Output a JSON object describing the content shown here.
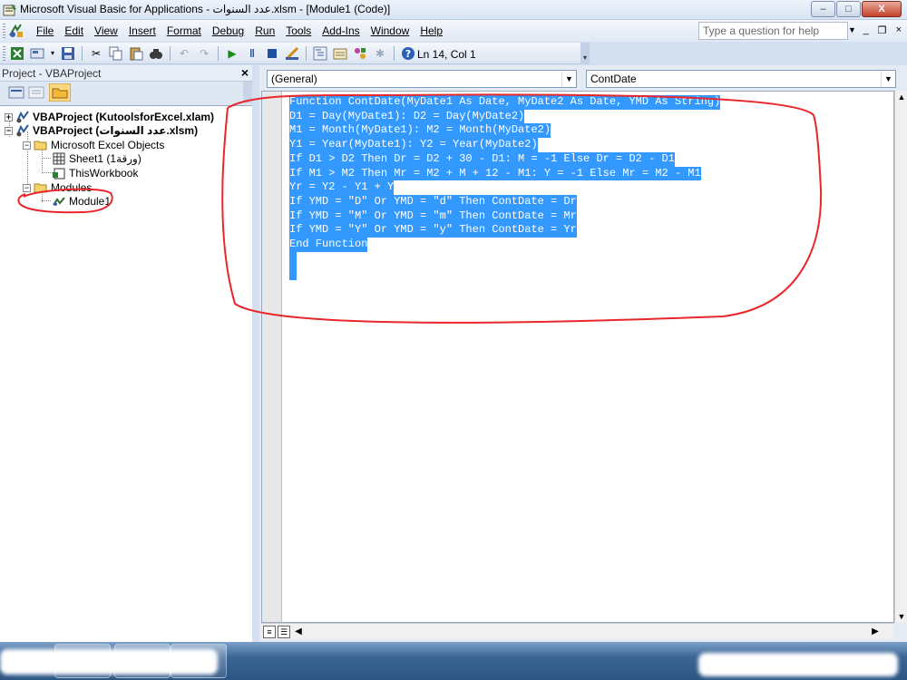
{
  "window": {
    "title": "Microsoft Visual Basic for Applications - عدد السنوات.xlsm - [Module1 (Code)]",
    "buttons": {
      "minimize": "–",
      "maximize": "□",
      "close": "X"
    }
  },
  "menubar": {
    "items": [
      "File",
      "Edit",
      "View",
      "Insert",
      "Format",
      "Debug",
      "Run",
      "Tools",
      "Add-Ins",
      "Window",
      "Help"
    ],
    "help_placeholder": "Type a question for help",
    "mdi_buttons": {
      "minimize": "_",
      "restore": "❐",
      "close": "×"
    }
  },
  "toolbar": {
    "status": "Ln 14, Col 1"
  },
  "project_pane": {
    "title": "Project - VBAProject",
    "close": "×",
    "tree": [
      {
        "label": "VBAProject (KutoolsforExcel.xlam)",
        "bold": true,
        "expander": "+"
      },
      {
        "label": "VBAProject (عدد السنوات.xlsm)",
        "bold": true,
        "expander": "−"
      },
      {
        "label": "Microsoft Excel Objects",
        "bold": false,
        "expander": "−"
      },
      {
        "label": "Sheet1 (ورقة1)",
        "bold": false
      },
      {
        "label": "ThisWorkbook",
        "bold": false
      },
      {
        "label": "Modules",
        "bold": false,
        "expander": "−"
      },
      {
        "label": "Module1",
        "bold": false
      }
    ]
  },
  "code_window": {
    "object_combo": "(General)",
    "procedure_combo": "ContDate",
    "lines": [
      "Function ContDate(MyDate1 As Date, MyDate2 As Date, YMD As String)",
      "D1 = Day(MyDate1): D2 = Day(MyDate2)",
      "M1 = Month(MyDate1): M2 = Month(MyDate2)",
      "Y1 = Year(MyDate1): Y2 = Year(MyDate2)",
      "If D1 > D2 Then Dr = D2 + 30 - D1: M = -1 Else Dr = D2 - D1",
      "If M1 > M2 Then Mr = M2 + M + 12 - M1: Y = -1 Else Mr = M2 - M1",
      "Yr = Y2 - Y1 + Y",
      "If YMD = \"D\" Or YMD = \"d\" Then ContDate = Dr",
      "If YMD = \"M\" Or YMD = \"m\" Then ContDate = Mr",
      "If YMD = \"Y\" Or YMD = \"y\" Then ContDate = Yr",
      "End Function"
    ]
  },
  "colors": {
    "selection": "#3399ff",
    "annotation": "#e8262b"
  }
}
